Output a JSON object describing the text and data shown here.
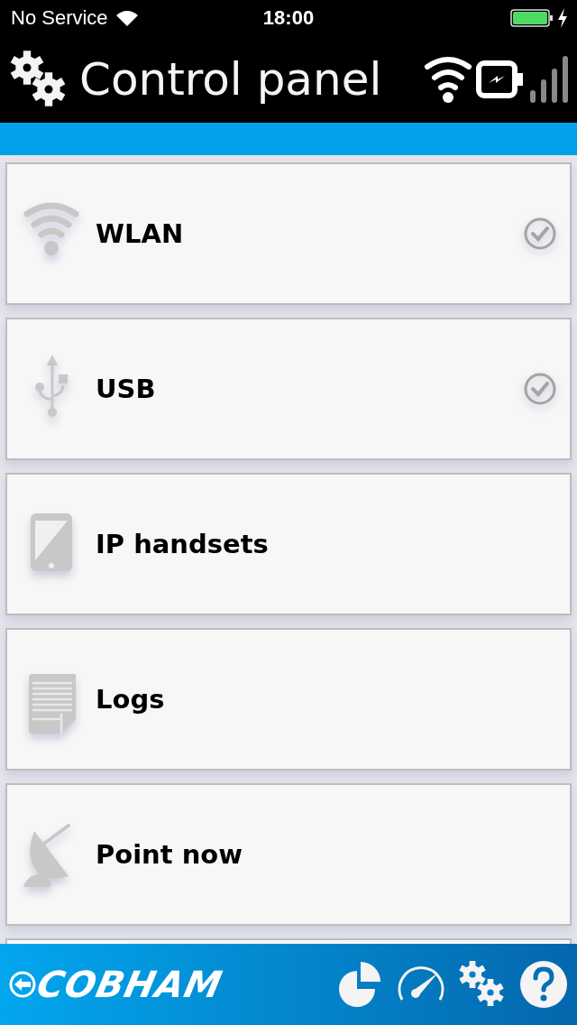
{
  "status_bar": {
    "carrier": "No Service",
    "time": "18:00"
  },
  "header": {
    "title": "Control panel"
  },
  "items": [
    {
      "label": "WLAN",
      "checked": true
    },
    {
      "label": "USB",
      "checked": true
    },
    {
      "label": "IP handsets",
      "checked": false
    },
    {
      "label": "Logs",
      "checked": false
    },
    {
      "label": "Point now",
      "checked": false
    }
  ],
  "footer": {
    "logo": "COBHAM"
  }
}
